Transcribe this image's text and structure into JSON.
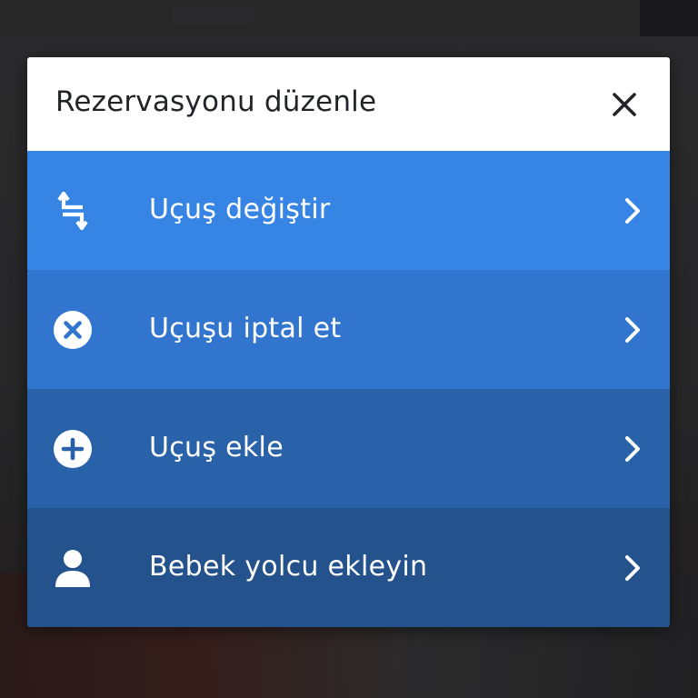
{
  "dialog": {
    "title": "Rezervasyonu düzenle",
    "close_icon": "close-icon"
  },
  "menu": {
    "items": [
      {
        "label": "Uçuş değiştir",
        "icon": "swap-arrows-icon",
        "color": "#3684e4"
      },
      {
        "label": "Uçuşu iptal et",
        "icon": "cancel-circle-icon",
        "color": "#3175cf"
      },
      {
        "label": "Uçuş ekle",
        "icon": "add-circle-icon",
        "color": "#2a62a9"
      },
      {
        "label": "Bebek yolcu ekleyin",
        "icon": "person-icon",
        "color": "#24528c"
      }
    ]
  },
  "colors": {
    "header_bg": "#ffffff",
    "title_text": "#222428",
    "item_text": "#ffffff"
  }
}
